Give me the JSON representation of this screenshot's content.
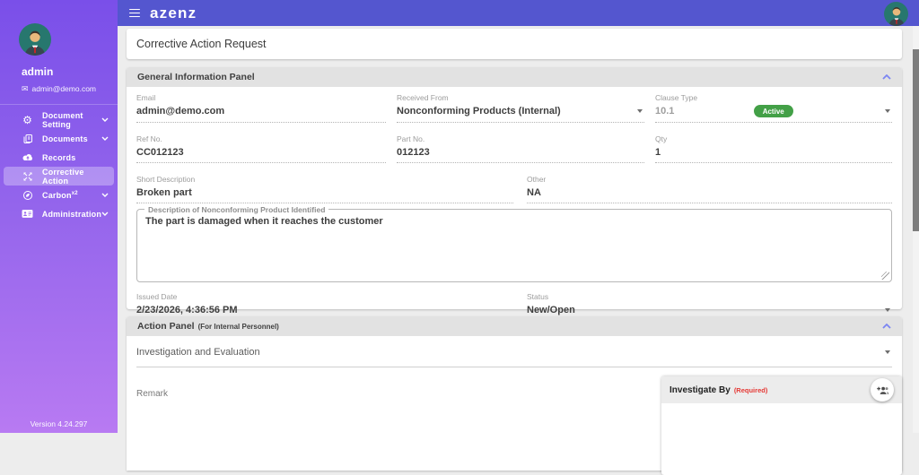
{
  "colors": {
    "topbar": "#5456cf",
    "sidebar_gradient_top": "#7a4fe9",
    "sidebar_gradient_bottom": "#b87af2",
    "active_badge_green": "#43a047",
    "required_red": "#e53935",
    "collapse_chevron_purple": "#7c86f2"
  },
  "topbar": {
    "logo": "azenz"
  },
  "user": {
    "name": "admin",
    "email": "admin@demo.com"
  },
  "sidebar": {
    "items": [
      {
        "label": "Document Setting",
        "icon": "gears-icon",
        "expandable": true,
        "active": false
      },
      {
        "label": "Documents",
        "icon": "documents-icon",
        "expandable": true,
        "active": false
      },
      {
        "label": "Records",
        "icon": "cloud-upload-icon",
        "expandable": false,
        "active": false
      },
      {
        "label": "Corrective Action",
        "icon": "corrective-action-icon",
        "expandable": false,
        "active": true
      },
      {
        "label": "Carbon",
        "sup": "x2",
        "icon": "carbon-icon",
        "expandable": true,
        "active": false
      },
      {
        "label": "Administration",
        "icon": "id-card-icon",
        "expandable": true,
        "active": false
      }
    ],
    "version": "Version 4.24.297"
  },
  "page": {
    "title": "Corrective Action Request"
  },
  "general_panel": {
    "title": "General Information Panel",
    "fields": {
      "email": {
        "label": "Email",
        "value": "admin@demo.com"
      },
      "received_from": {
        "label": "Received From",
        "value": "Nonconforming Products (Internal)"
      },
      "clause_type": {
        "label": "Clause Type",
        "value": "10.1",
        "badge": "Active"
      },
      "ref_no": {
        "label": "Ref No.",
        "value": "CC012123"
      },
      "part_no": {
        "label": "Part No.",
        "value": "012123"
      },
      "qty": {
        "label": "Qty",
        "value": "1"
      },
      "short_description": {
        "label": "Short Description",
        "value": "Broken part"
      },
      "other": {
        "label": "Other",
        "value": "NA"
      },
      "description": {
        "label": "Description of Nonconforming Product Identified",
        "value": "The part is damaged when it reaches the customer"
      },
      "issued_date": {
        "label": "Issued Date",
        "value": "2/23/2026, 4:36:56 PM"
      },
      "status": {
        "label": "Status",
        "value": "New/Open"
      }
    }
  },
  "action_panel": {
    "title": "Action Panel",
    "subtitle": "(For Internal Personnel)",
    "section_label": "Investigation and Evaluation",
    "remark_label": "Remark",
    "investigate_by": {
      "label": "Investigate By",
      "required_note": "(Required)"
    }
  }
}
